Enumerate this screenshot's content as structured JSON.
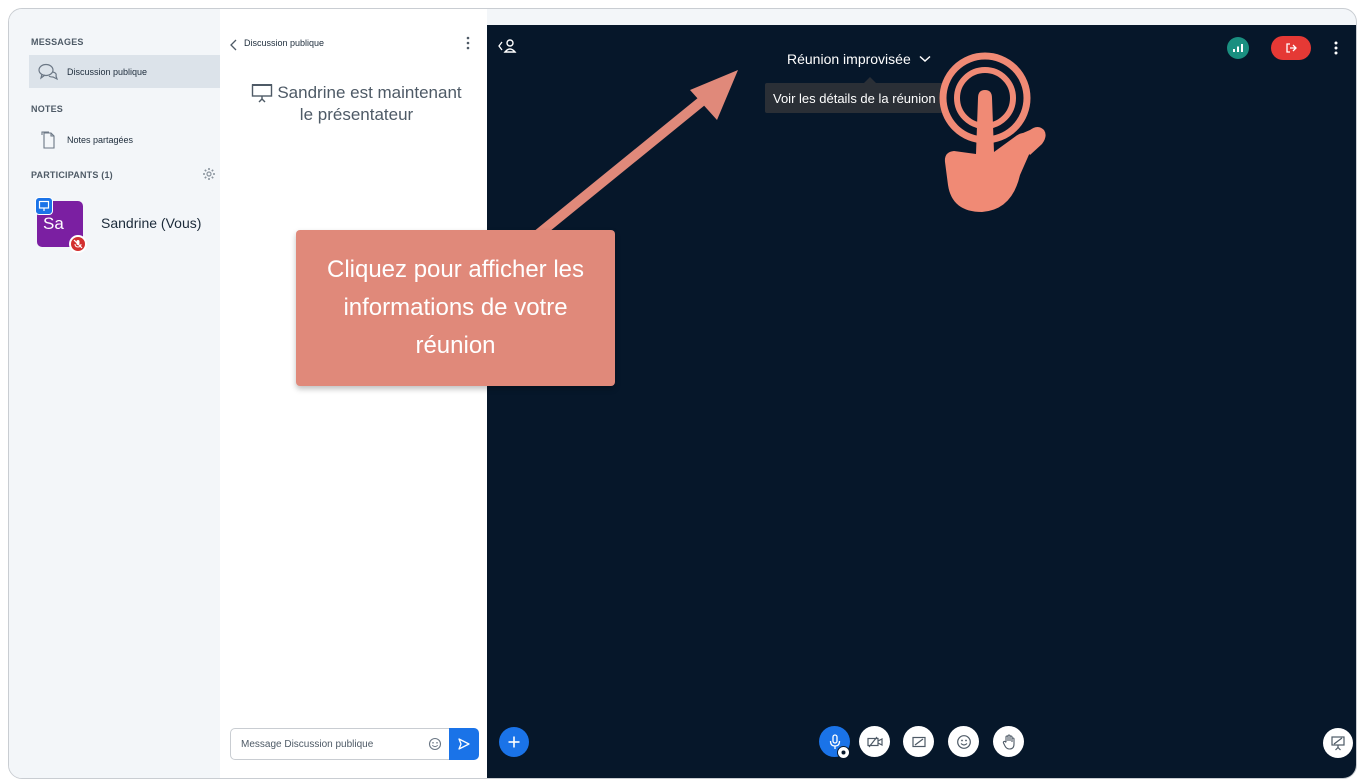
{
  "sidebar": {
    "messages_title": "MESSAGES",
    "public_chat_label": "Discussion publique",
    "notes_title": "NOTES",
    "shared_notes_label": "Notes partagées",
    "participants_title": "PARTICIPANTS (1)",
    "participant": {
      "initials": "Sa",
      "name": "Sandrine (Vous)",
      "color": "#7b1fa2"
    }
  },
  "chat": {
    "title": "Discussion publique",
    "system_message_line1": "Sandrine est maintenant",
    "system_message_line2": "le présentateur",
    "input_placeholder": "Message Discussion publique"
  },
  "meeting": {
    "title": "Réunion improvisée",
    "tooltip": "Voir les détails de la réunion",
    "background_color": "#06172a"
  },
  "annotation": {
    "text": "Cliquez pour afficher les informations de votre réunion",
    "color": "#e0897a"
  },
  "colors": {
    "accent": "#1a73e8",
    "leave": "#e53935",
    "connection": "#1a8f80"
  }
}
